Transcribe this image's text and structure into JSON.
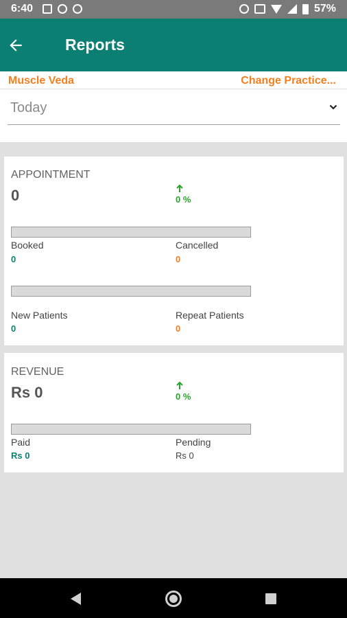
{
  "status_bar": {
    "time": "6:40",
    "battery": "57%"
  },
  "app_bar": {
    "title": "Reports"
  },
  "practice": {
    "name": "Muscle Veda",
    "change_label": "Change Practice..."
  },
  "period": {
    "selected": "Today"
  },
  "appointment": {
    "title": "APPOINTMENT",
    "total": "0",
    "change": "0 %",
    "booked_label": "Booked",
    "booked_value": "0",
    "cancelled_label": "Cancelled",
    "cancelled_value": "0",
    "booked_fraction": 0,
    "new_label": "New Patients",
    "new_value": "0",
    "repeat_label": "Repeat Patients",
    "repeat_value": "0",
    "new_fraction": 0
  },
  "revenue": {
    "title": "REVENUE",
    "total": "Rs 0",
    "change": "0 %",
    "paid_label": "Paid",
    "paid_value": "Rs 0",
    "pending_label": "Pending",
    "pending_value": "Rs 0",
    "paid_fraction": 0
  },
  "colors": {
    "primary": "#0a7f72",
    "accent": "#f07f1f",
    "positive": "#2ca02c"
  }
}
